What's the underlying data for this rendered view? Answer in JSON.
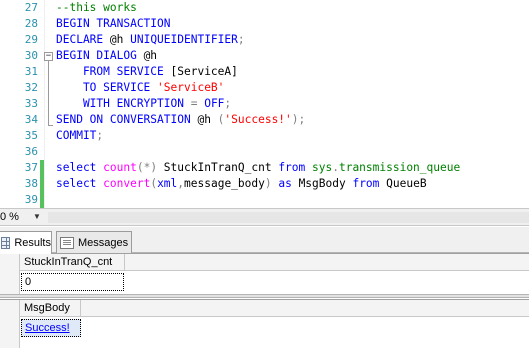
{
  "editor": {
    "line_numbers": [
      "27",
      "28",
      "29",
      "30",
      "31",
      "32",
      "33",
      "34",
      "35",
      "36",
      "37",
      "38",
      "39"
    ],
    "lines": [
      [
        {
          "t": "--this works",
          "c": "cmt"
        }
      ],
      [
        {
          "t": "BEGIN TRANSACTION",
          "c": "kw"
        }
      ],
      [
        {
          "t": "DECLARE ",
          "c": "kw"
        },
        {
          "t": "@h ",
          "c": ""
        },
        {
          "t": "UNIQUEIDENTIFIER",
          "c": "kw"
        },
        {
          "t": ";",
          "c": "op"
        }
      ],
      [
        {
          "t": "BEGIN DIALOG ",
          "c": "kw"
        },
        {
          "t": "@h",
          "c": ""
        }
      ],
      [
        {
          "t": "    FROM SERVICE ",
          "c": "kw"
        },
        {
          "t": "[ServiceA]",
          "c": ""
        }
      ],
      [
        {
          "t": "    TO SERVICE ",
          "c": "kw"
        },
        {
          "t": "'ServiceB'",
          "c": "str"
        }
      ],
      [
        {
          "t": "    WITH ENCRYPTION ",
          "c": "kw"
        },
        {
          "t": "= ",
          "c": "op"
        },
        {
          "t": "OFF",
          "c": "kw"
        },
        {
          "t": ";",
          "c": "op"
        }
      ],
      [
        {
          "t": "SEND ON CONVERSATION ",
          "c": "kw"
        },
        {
          "t": "@h ",
          "c": ""
        },
        {
          "t": "(",
          "c": "op"
        },
        {
          "t": "'Success!'",
          "c": "str"
        },
        {
          "t": ");",
          "c": "op"
        }
      ],
      [
        {
          "t": "COMMIT",
          "c": "kw"
        },
        {
          "t": ";",
          "c": "op"
        }
      ],
      [],
      [
        {
          "t": "select ",
          "c": "kw"
        },
        {
          "t": "count",
          "c": "fn"
        },
        {
          "t": "(*) ",
          "c": "op"
        },
        {
          "t": "StuckInTranQ_cnt ",
          "c": ""
        },
        {
          "t": "from ",
          "c": "kw"
        },
        {
          "t": "sys",
          "c": "sys"
        },
        {
          "t": ".",
          "c": "op"
        },
        {
          "t": "transmission_queue",
          "c": "sys"
        }
      ],
      [
        {
          "t": "select ",
          "c": "kw"
        },
        {
          "t": "convert",
          "c": "fn"
        },
        {
          "t": "(",
          "c": "op"
        },
        {
          "t": "xml",
          "c": "kw"
        },
        {
          "t": ",",
          "c": "op"
        },
        {
          "t": "message_body",
          "c": ""
        },
        {
          "t": ") ",
          "c": "op"
        },
        {
          "t": "as ",
          "c": "kw"
        },
        {
          "t": "MsgBody ",
          "c": ""
        },
        {
          "t": "from ",
          "c": "kw"
        },
        {
          "t": "QueueB",
          "c": ""
        }
      ],
      []
    ],
    "colors": {
      "keyword": "#0000ff",
      "function": "#ff00ff",
      "string": "#ff0000",
      "operator": "#808080",
      "system": "#008000",
      "comment": "#008000",
      "line_number": "#2b91af",
      "changed_saved": "#57c15e",
      "changed_unsaved": "#f7e66a"
    }
  },
  "zoom": {
    "value": "0 %"
  },
  "tabs": [
    {
      "label": "Results",
      "icon": "grid-icon",
      "active": true
    },
    {
      "label": "Messages",
      "icon": "messages-icon",
      "active": false
    }
  ],
  "results": [
    {
      "column": "StuckInTranQ_cnt",
      "rows": [
        [
          "0"
        ]
      ]
    },
    {
      "column": "MsgBody",
      "rows": [
        [
          "Success!"
        ]
      ]
    }
  ]
}
